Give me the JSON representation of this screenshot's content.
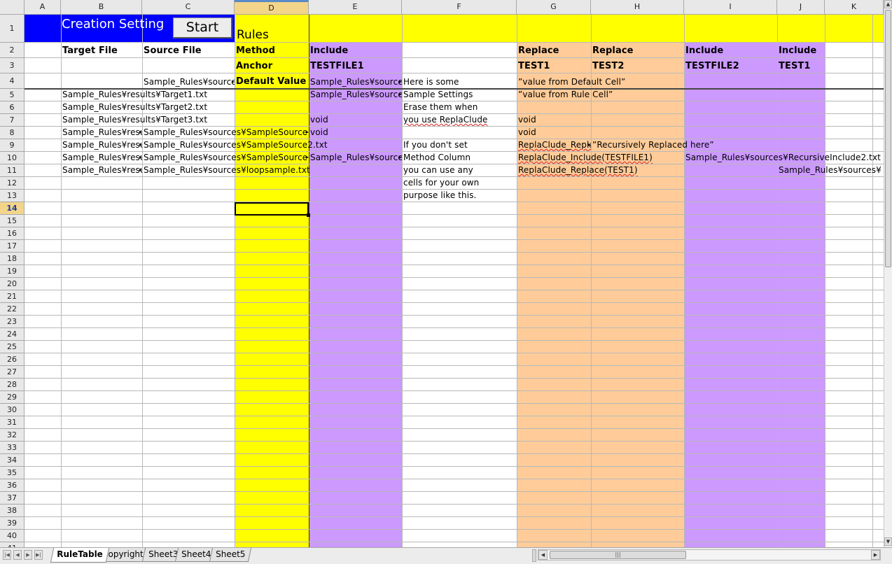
{
  "columns": [
    {
      "letter": "A"
    },
    {
      "letter": "B"
    },
    {
      "letter": "C"
    },
    {
      "letter": "D"
    },
    {
      "letter": "E"
    },
    {
      "letter": "F"
    },
    {
      "letter": "G"
    },
    {
      "letter": "H"
    },
    {
      "letter": "I"
    },
    {
      "letter": "J"
    },
    {
      "letter": "K"
    }
  ],
  "selected_column": "D",
  "selected_row": "14",
  "colors": {
    "yellow": "#ffff00",
    "purple": "#cc99ff",
    "orange": "#ffcc99",
    "blue_banner": "#0000ff"
  },
  "header": {
    "creation_setting": "Creation Setting",
    "start_button": "Start",
    "rules_label": "Rules"
  },
  "cells": [
    {
      "col": "B",
      "row": 2,
      "text": "Target File",
      "bold": true
    },
    {
      "col": "C",
      "row": 2,
      "text": "Source File",
      "bold": true
    },
    {
      "col": "D",
      "row": 2,
      "text": "Method",
      "bold": true
    },
    {
      "col": "E",
      "row": 2,
      "text": "Include",
      "bold": true
    },
    {
      "col": "G",
      "row": 2,
      "text": "Replace",
      "bold": true
    },
    {
      "col": "H",
      "row": 2,
      "text": "Replace",
      "bold": true
    },
    {
      "col": "I",
      "row": 2,
      "text": "Include",
      "bold": true
    },
    {
      "col": "J",
      "row": 2,
      "text": "Include",
      "bold": true
    },
    {
      "col": "D",
      "row": 3,
      "text": "Anchor",
      "bold": true
    },
    {
      "col": "E",
      "row": 3,
      "text": "TESTFILE1",
      "bold": true
    },
    {
      "col": "G",
      "row": 3,
      "text": "TEST1",
      "bold": true
    },
    {
      "col": "H",
      "row": 3,
      "text": "TEST2",
      "bold": true
    },
    {
      "col": "I",
      "row": 3,
      "text": "TESTFILE2",
      "bold": true
    },
    {
      "col": "J",
      "row": 3,
      "text": "TEST1",
      "bold": true
    },
    {
      "col": "C",
      "row": 4,
      "text": "Sample_Rules¥sources",
      "clip": true
    },
    {
      "col": "D",
      "row": 4,
      "text": "Default Value",
      "bold": true
    },
    {
      "col": "E",
      "row": 4,
      "text": "Sample_Rules¥sources",
      "clip": true
    },
    {
      "col": "F",
      "row": 4,
      "text": "  Here is some"
    },
    {
      "col": "G",
      "row": 4,
      "text": "”value from Default Cell”",
      "over": true
    },
    {
      "col": "B",
      "row": 5,
      "text": "Sample_Rules¥results¥Target1.txt",
      "over": true
    },
    {
      "col": "E",
      "row": 5,
      "text": "Sample_Rules¥sources",
      "clip": true
    },
    {
      "col": "F",
      "row": 5,
      "text": "  Sample Settings"
    },
    {
      "col": "G",
      "row": 5,
      "text": "”value from Rule Cell”",
      "over": true
    },
    {
      "col": "B",
      "row": 6,
      "text": "Sample_Rules¥results¥Target2.txt",
      "over": true
    },
    {
      "col": "F",
      "row": 6,
      "text": "  Erase them when"
    },
    {
      "col": "B",
      "row": 7,
      "text": "Sample_Rules¥results¥Target3.txt",
      "over": true
    },
    {
      "col": "E",
      "row": 7,
      "text": "void"
    },
    {
      "col": "F",
      "row": 7,
      "text": "  you use ReplaClude",
      "ul": true
    },
    {
      "col": "G",
      "row": 7,
      "text": "void"
    },
    {
      "col": "B",
      "row": 8,
      "text": "Sample_Rules¥results",
      "clip": true
    },
    {
      "col": "C",
      "row": 8,
      "text": "Sample_Rules¥sources¥SampleSource",
      "clip": true,
      "over2": true
    },
    {
      "col": "E",
      "row": 8,
      "text": "void"
    },
    {
      "col": "G",
      "row": 8,
      "text": "void"
    },
    {
      "col": "B",
      "row": 9,
      "text": "Sample_Rules¥results",
      "clip": true
    },
    {
      "col": "C",
      "row": 9,
      "text": "Sample_Rules¥sources¥SampleSource2.txt",
      "over": true
    },
    {
      "col": "F",
      "row": 9,
      "text": "  If you don't set"
    },
    {
      "col": "G",
      "row": 9,
      "text": "ReplaClude_Replace",
      "clip": true,
      "ul": true
    },
    {
      "col": "H",
      "row": 9,
      "text": "”Recursively Replaced here”",
      "over": true
    },
    {
      "col": "B",
      "row": 10,
      "text": "Sample_Rules¥results",
      "clip": true
    },
    {
      "col": "C",
      "row": 10,
      "text": "Sample_Rules¥sources¥SampleSource",
      "clip": true,
      "over2": true
    },
    {
      "col": "E",
      "row": 10,
      "text": "Sample_Rules¥sources",
      "clip": true
    },
    {
      "col": "F",
      "row": 10,
      "text": "  Method Column"
    },
    {
      "col": "G",
      "row": 10,
      "text": "ReplaClude_Include(TESTFILE1)",
      "over": true,
      "ul": true
    },
    {
      "col": "I",
      "row": 10,
      "text": "Sample_Rules¥sources¥RecursiveInclude2.txt",
      "over": true
    },
    {
      "col": "B",
      "row": 11,
      "text": "Sample_Rules¥results",
      "clip": true
    },
    {
      "col": "C",
      "row": 11,
      "text": "Sample_Rules¥sources¥loopsample.txt",
      "over": true
    },
    {
      "col": "F",
      "row": 11,
      "text": "  you can use any"
    },
    {
      "col": "G",
      "row": 11,
      "text": "ReplaClude_Replace(TEST1)",
      "over": true,
      "ul": true
    },
    {
      "col": "J",
      "row": 11,
      "text": "Sample_Rules¥sources¥",
      "over": true
    },
    {
      "col": "F",
      "row": 12,
      "text": "  cells for your own"
    },
    {
      "col": "F",
      "row": 13,
      "text": "  purpose like this."
    }
  ],
  "sheet_tabs": [
    "RuleTable",
    "Copyright",
    "Sheet3",
    "Sheet4",
    "Sheet5"
  ],
  "active_tab": "RuleTable"
}
